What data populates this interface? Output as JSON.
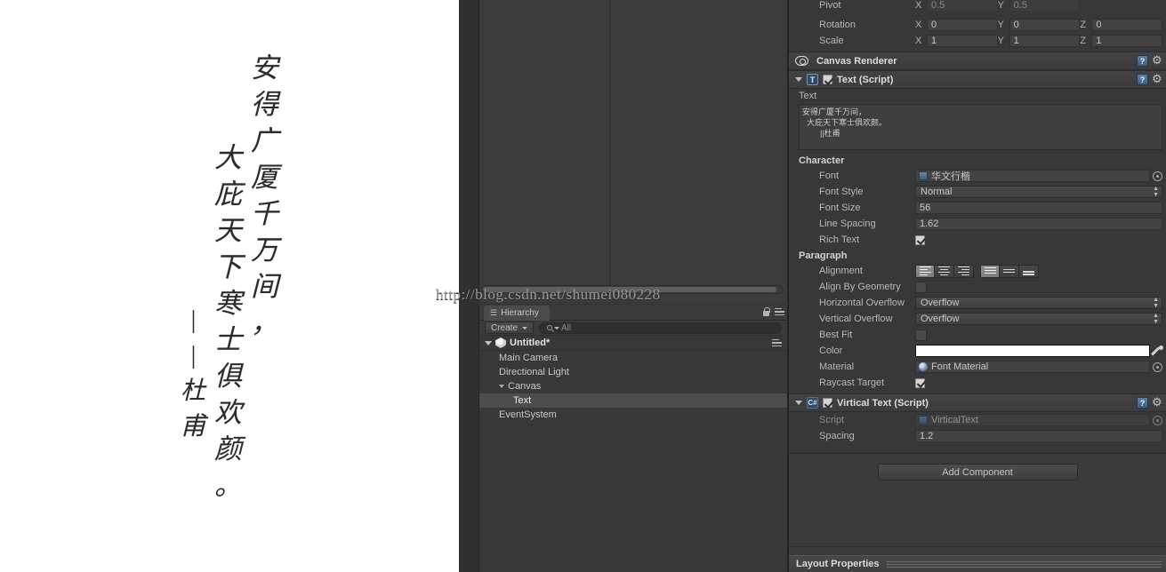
{
  "game_view": {
    "poem_columns": [
      {
        "chars": [
          "安",
          "得",
          "广",
          "厦",
          "千",
          "万",
          "间",
          "，"
        ]
      },
      {
        "chars": [
          "大",
          "庇",
          "天",
          "下",
          "寒",
          "士",
          "俱",
          "欢",
          "颜",
          "。"
        ]
      },
      {
        "chars": [
          "|",
          "|",
          "杜",
          "甫"
        ]
      }
    ],
    "watermark": "http://blog.csdn.net/shumei080228"
  },
  "hierarchy": {
    "tab_label": "Hierarchy",
    "tab_icon": "hierarchy-icon",
    "lock_icon": "lock-icon",
    "menu_icon": "hamburger-menu-icon",
    "create_label": "Create",
    "search_placeholder": "All",
    "scene_name": "Untitled*",
    "items": [
      {
        "label": "Main Camera",
        "level": 2,
        "selected": false,
        "expandable": false
      },
      {
        "label": "Directional Light",
        "level": 2,
        "selected": false,
        "expandable": false
      },
      {
        "label": "Canvas",
        "level": 2,
        "selected": false,
        "expandable": true
      },
      {
        "label": "Text",
        "level": 3,
        "selected": true,
        "expandable": false
      },
      {
        "label": "EventSystem",
        "level": 2,
        "selected": false,
        "expandable": false
      }
    ]
  },
  "inspector": {
    "transform": {
      "pivot": {
        "label": "Pivot",
        "x_axis": "X",
        "x": "0.5",
        "y_axis": "Y",
        "y": "0.5"
      },
      "rotation": {
        "label": "Rotation",
        "x_axis": "X",
        "x": "0",
        "y_axis": "Y",
        "y": "0",
        "z_axis": "Z",
        "z": "0"
      },
      "scale": {
        "label": "Scale",
        "x_axis": "X",
        "x": "1",
        "y_axis": "Y",
        "y": "1",
        "z_axis": "Z",
        "z": "1"
      }
    },
    "canvas_renderer": {
      "title": "Canvas Renderer",
      "icon": "eye-icon",
      "help_icon": "help-book-icon",
      "gear_icon": "gear-icon"
    },
    "text_component": {
      "title": "Text (Script)",
      "badge": "T",
      "enabled": true,
      "text_label": "Text",
      "text_value": "安得广厦千万间，\n  大庇天下寒士俱欢颜。\n        ||杜甫",
      "character_header": "Character",
      "font_label": "Font",
      "font_value": "华文行楷",
      "font_style_label": "Font Style",
      "font_style_value": "Normal",
      "font_size_label": "Font Size",
      "font_size_value": "56",
      "line_spacing_label": "Line Spacing",
      "line_spacing_value": "1.62",
      "rich_text_label": "Rich Text",
      "rich_text_checked": true,
      "paragraph_header": "Paragraph",
      "alignment_label": "Alignment",
      "alignment_horizontal": "left",
      "alignment_vertical": "top",
      "align_by_geometry_label": "Align By Geometry",
      "align_by_geometry_checked": false,
      "horizontal_overflow_label": "Horizontal Overflow",
      "horizontal_overflow_value": "Overflow",
      "vertical_overflow_label": "Vertical Overflow",
      "vertical_overflow_value": "Overflow",
      "best_fit_label": "Best Fit",
      "best_fit_checked": false,
      "color_label": "Color",
      "color_value": "#FFFFFF",
      "material_label": "Material",
      "material_value": "Font Material",
      "raycast_target_label": "Raycast Target",
      "raycast_target_checked": true
    },
    "virtical_text_component": {
      "title": "Virtical Text (Script)",
      "badge": "C#",
      "enabled": true,
      "script_label": "Script",
      "script_value": "VirticalText",
      "spacing_label": "Spacing",
      "spacing_value": "1.2"
    },
    "add_component_label": "Add Component",
    "layout_properties_label": "Layout Properties"
  }
}
